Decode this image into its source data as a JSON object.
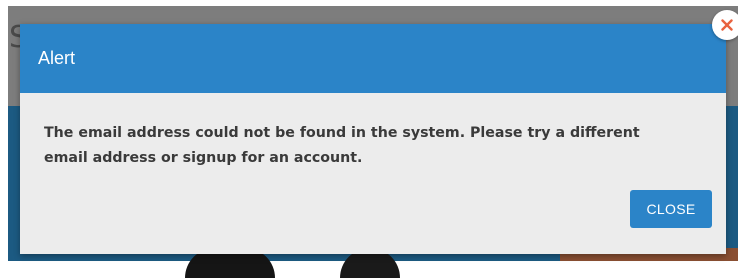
{
  "background": {
    "partial_letter": "S"
  },
  "dialog": {
    "title": "Alert",
    "message": "The email address could not be found in the system. Please try a different email address or signup for an account.",
    "close_button_label": "CLOSE",
    "close_icon": "close-icon"
  },
  "colors": {
    "header": "#2b84c8",
    "button": "#2b84c8",
    "body_bg": "#ececec",
    "close_icon": "#e8623f"
  }
}
